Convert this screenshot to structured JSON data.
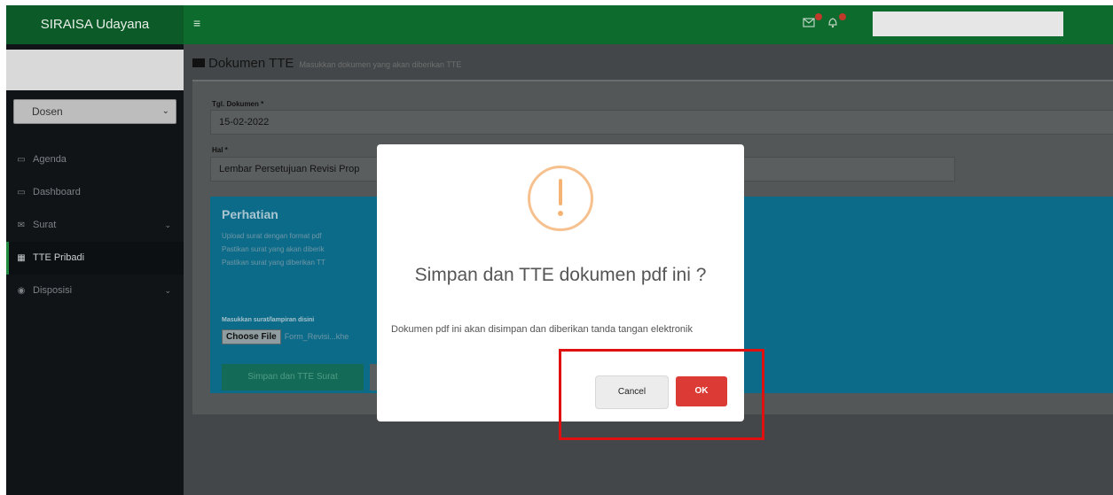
{
  "app": {
    "brand": "SIRAISA Udayana"
  },
  "topbar": {
    "menu_icon": "hamburger-icon",
    "mail_icon": "mail-icon",
    "bell_icon": "bell-icon"
  },
  "sidebar": {
    "role": "Dosen",
    "items": [
      {
        "label": "Agenda",
        "icon": "calendar-icon",
        "glyph": "▭"
      },
      {
        "label": "Dashboard",
        "icon": "monitor-icon",
        "glyph": "▭"
      },
      {
        "label": "Surat",
        "icon": "envelope-icon",
        "glyph": "✉",
        "chevron": "⌄"
      },
      {
        "label": "TTE Pribadi",
        "icon": "calendar-icon",
        "glyph": "▦",
        "active": true
      },
      {
        "label": "Disposisi",
        "icon": "eye-icon",
        "glyph": "◉",
        "chevron": "⌄"
      }
    ]
  },
  "page": {
    "title": "Dokumen TTE",
    "subtitle": "Masukkan dokumen yang akan diberikan TTE"
  },
  "form": {
    "date_label": "Tgl. Dokumen *",
    "date_value": "15-02-2022",
    "hal_label": "Hal *",
    "hal_value": "Lembar Persetujuan Revisi Prop"
  },
  "notice": {
    "title": "Perhatian",
    "lines": [
      "Upload surat dengan format pdf",
      "Pastikan surat yang akan diberik",
      "Pastikan surat yang diberikan TT"
    ],
    "file_label": "Masukkan surat/lampiran disini",
    "choose_file": "Choose File",
    "file_name": "Form_Revisi...khe",
    "submit": "Simpan dan TTE Surat"
  },
  "modal": {
    "icon": "warning-icon",
    "title": "Simpan dan TTE dokumen pdf ini ?",
    "text": "Dokumen pdf ini akan disimpan dan diberikan tanda tangan elektronik",
    "cancel": "Cancel",
    "ok": "OK"
  },
  "colors": {
    "brand_green": "#0d6b2e",
    "info_blue": "#0d6b8a",
    "ok_red": "#dc3a35",
    "warning_orange": "#f5b473",
    "highlight_red": "#e01010"
  }
}
